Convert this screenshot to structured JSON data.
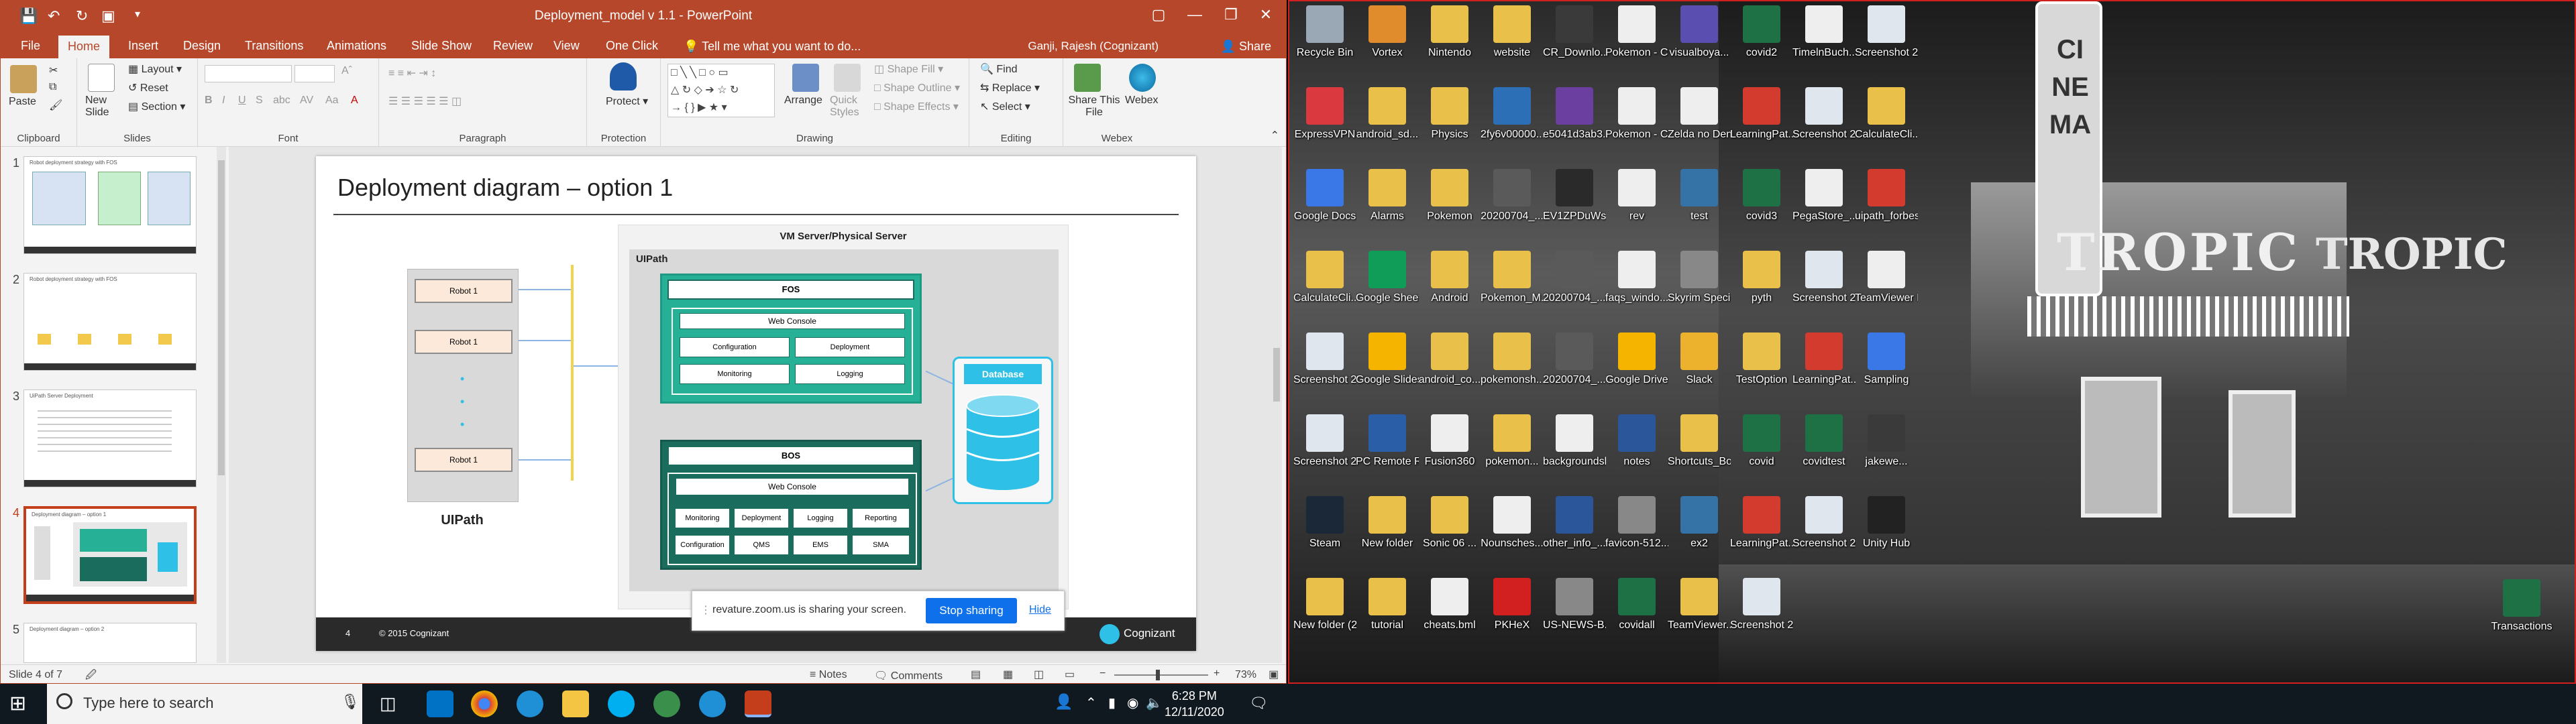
{
  "app": {
    "title": "Deployment_model v 1.1 - PowerPoint",
    "user": "Ganji, Rajesh (Cognizant)",
    "share": "Share",
    "tell_me": "Tell me what you want to do..."
  },
  "tabs": [
    "File",
    "Home",
    "Insert",
    "Design",
    "Transitions",
    "Animations",
    "Slide Show",
    "Review",
    "View",
    "One Click"
  ],
  "ribbon": {
    "clipboard": {
      "label": "Clipboard",
      "paste": "Paste"
    },
    "slides": {
      "label": "Slides",
      "new_slide": "New Slide",
      "layout": "Layout",
      "reset": "Reset",
      "section": "Section"
    },
    "font": {
      "label": "Font"
    },
    "paragraph": {
      "label": "Paragraph"
    },
    "protection": {
      "label": "Protection",
      "protect": "Protect"
    },
    "drawing": {
      "label": "Drawing",
      "arrange": "Arrange",
      "quick_styles": "Quick Styles",
      "shape_fill": "Shape Fill",
      "shape_outline": "Shape Outline",
      "shape_effects": "Shape Effects"
    },
    "editing": {
      "label": "Editing",
      "find": "Find",
      "replace": "Replace",
      "select": "Select"
    },
    "webex": {
      "label": "Webex",
      "share_this_file": "Share This File",
      "webex": "Webex"
    }
  },
  "thumbnails": [
    {
      "num": "1",
      "title": "Robot deployment strategy with FOS"
    },
    {
      "num": "2",
      "title": "Robot deployment strategy with FOS"
    },
    {
      "num": "3",
      "title": "UiPath Server Deployment"
    },
    {
      "num": "4",
      "title": "Deployment diagram – option 1"
    },
    {
      "num": "5",
      "title": "Deployment diagram – option 2"
    }
  ],
  "slide": {
    "title": "Deployment diagram – option 1",
    "robots": [
      "Robot 1",
      "Robot 1",
      "Robot 1"
    ],
    "robots_caption": "UIPath",
    "server_title": "VM Server/Physical Server",
    "uipath_label": "UIPath",
    "fos": {
      "title": "FOS",
      "web_console": "Web Console",
      "cells": [
        "Configuration",
        "Deployment",
        "Monitoring",
        "Logging"
      ]
    },
    "bos": {
      "title": "BOS",
      "web_console": "Web Console",
      "row1": [
        "Monitoring",
        "Deployment",
        "Logging",
        "Reporting"
      ],
      "row2": [
        "Configuration",
        "QMS",
        "EMS",
        "SMA"
      ]
    },
    "database": "Database",
    "footer_page": "4",
    "footer_copy": "© 2015 Cognizant",
    "footer_brand": "Cognizant"
  },
  "zoom_share": {
    "text": "revature.zoom.us is sharing your screen.",
    "stop": "Stop sharing",
    "hide": "Hide"
  },
  "status": {
    "slide": "Slide 4 of 7",
    "notes": "Notes",
    "comments": "Comments",
    "zoom": "73%"
  },
  "desktop_icons": [
    {
      "label": "Recycle Bin",
      "color": "#9aa7b4"
    },
    {
      "label": "Vortex",
      "color": "#e08b2c"
    },
    {
      "label": "Nintendo",
      "color": "#e8c04a"
    },
    {
      "label": "website",
      "color": "#e8c04a"
    },
    {
      "label": "CR_Downlo...",
      "color": "#3a3a3a"
    },
    {
      "label": "Pokemon - Crystal Versi...",
      "color": "#eeeeee"
    },
    {
      "label": "visualboya...",
      "color": "#5a4fb0"
    },
    {
      "label": "covid2",
      "color": "#1e7145"
    },
    {
      "label": "TimelnBuch...",
      "color": "#eeeeee"
    },
    {
      "label": "Screenshot 2020-12-...",
      "color": "#dfe6ee"
    },
    {
      "label": "ExpressVPN",
      "color": "#da3940"
    },
    {
      "label": "android_sd...",
      "color": "#e8c04a"
    },
    {
      "label": "Physics",
      "color": "#e8c04a"
    },
    {
      "label": "2fy6v00000...",
      "color": "#2c6fb7"
    },
    {
      "label": "e5041d3ab3...",
      "color": "#6b3fa0"
    },
    {
      "label": "Pokemon - Crystal Versi...",
      "color": "#eeeeee"
    },
    {
      "label": "Zelda no Densetsu -...",
      "color": "#eeeeee"
    },
    {
      "label": "LearningPat...",
      "color": "#d43b2f"
    },
    {
      "label": "Screenshot 2020-11-...",
      "color": "#dfe6ee"
    },
    {
      "label": "CalculateCli...",
      "color": "#e8c04a"
    },
    {
      "label": "Google Docs",
      "color": "#3b78e7"
    },
    {
      "label": "Alarms",
      "color": "#e8c04a"
    },
    {
      "label": "Pokemon",
      "color": "#e8c04a"
    },
    {
      "label": "20200704_...",
      "color": "#5a5a5a"
    },
    {
      "label": "EV1ZPDuWs...",
      "color": "#2a2a2a"
    },
    {
      "label": "rev",
      "color": "#eeeeee"
    },
    {
      "label": "test",
      "color": "#3572a5"
    },
    {
      "label": "covid3",
      "color": "#1e7145"
    },
    {
      "label": "PegaStore_...",
      "color": "#eeeeee"
    },
    {
      "label": "uipath_forbes",
      "color": "#d43b2f"
    },
    {
      "label": "CalculateCli...",
      "color": "#e8c04a"
    },
    {
      "label": "Google Sheets",
      "color": "#0f9d58"
    },
    {
      "label": "Android",
      "color": "#e8c04a"
    },
    {
      "label": "Pokemon_M...",
      "color": "#e8c04a"
    },
    {
      "label": "20200704_...(1)",
      "color": "#5a5a5a"
    },
    {
      "label": "faqs_windo...",
      "color": "#eeeeee"
    },
    {
      "label": "Skyrim Special Edition - St...",
      "color": "#888888"
    },
    {
      "label": "pyth",
      "color": "#e8c04a"
    },
    {
      "label": "Screenshot 2020-11-...",
      "color": "#dfe6ee"
    },
    {
      "label": "TeamViewer Po...",
      "color": "#eeeeee"
    },
    {
      "label": "Screenshot 2020-11-...",
      "color": "#dfe6ee"
    },
    {
      "label": "Google Slides",
      "color": "#f4b400"
    },
    {
      "label": "android_co...",
      "color": "#e8c04a"
    },
    {
      "label": "pokemonsh...",
      "color": "#e8c04a"
    },
    {
      "label": "20200704_...",
      "color": "#5a5a5a"
    },
    {
      "label": "Google Drive",
      "color": "#f4b400"
    },
    {
      "label": "Slack",
      "color": "#ecb22e"
    },
    {
      "label": "TestOption",
      "color": "#e8c04a"
    },
    {
      "label": "LearningPat...",
      "color": "#d43b2f"
    },
    {
      "label": "Sampling",
      "color": "#3b78e7"
    },
    {
      "label": "Screenshot 2020-12-...",
      "color": "#dfe6ee"
    },
    {
      "label": "PC Remote Receiver",
      "color": "#2a5fa8"
    },
    {
      "label": "Fusion360",
      "color": "#eeeeee"
    },
    {
      "label": "pokemon...",
      "color": "#e8c04a"
    },
    {
      "label": "backgroundsketches-...",
      "color": "#eeeeee"
    },
    {
      "label": "notes",
      "color": "#2b579a"
    },
    {
      "label": "Shortcuts_Bookmar...",
      "color": "#e8c04a"
    },
    {
      "label": "covid",
      "color": "#1e7145"
    },
    {
      "label": "covidtest",
      "color": "#1e7145"
    },
    {
      "label": "jakewe...",
      "color": "#3a3a3a"
    },
    {
      "label": "Steam",
      "color": "#1b2838"
    },
    {
      "label": "New folder",
      "color": "#e8c04a"
    },
    {
      "label": "Sonic 06 ...",
      "color": "#e8c04a"
    },
    {
      "label": "Nounsches...",
      "color": "#eeeeee"
    },
    {
      "label": "other_info_...",
      "color": "#2b579a"
    },
    {
      "label": "favicon-512...",
      "color": "#888888"
    },
    {
      "label": "ex2",
      "color": "#3572a5"
    },
    {
      "label": "LearningPat...",
      "color": "#d43b2f"
    },
    {
      "label": "Screenshot 2020-12-...",
      "color": "#dfe6ee"
    },
    {
      "label": "Unity Hub",
      "color": "#222222"
    },
    {
      "label": "New folder (2)",
      "color": "#e8c04a"
    },
    {
      "label": "tutorial",
      "color": "#e8c04a"
    },
    {
      "label": "cheats.bml",
      "color": "#eeeeee"
    },
    {
      "label": "PKHeX",
      "color": "#d21f1f"
    },
    {
      "label": "US-NEWS-B...",
      "color": "#888888"
    },
    {
      "label": "covidall",
      "color": "#1e7145"
    },
    {
      "label": "TeamViewer...",
      "color": "#e8c04a"
    },
    {
      "label": "Screenshot 2020-12-...",
      "color": "#dfe6ee"
    },
    {
      "label": "Transactions",
      "color": "#1e7145"
    }
  ],
  "marquee": {
    "sign": "CINEMA",
    "front": "TROPIC",
    "side": "TROPIC"
  },
  "taskbar": {
    "search": "Type here to search",
    "time": "6:28 PM",
    "date": "12/11/2020"
  }
}
